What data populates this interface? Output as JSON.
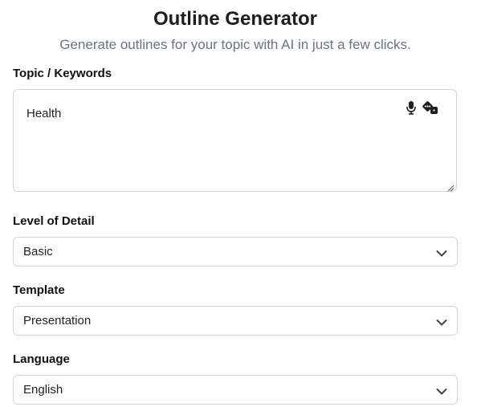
{
  "header": {
    "title": "Outline Generator",
    "subtitle": "Generate outlines for your topic with AI in just a few clicks."
  },
  "topic": {
    "label": "Topic / Keywords",
    "value": "Health",
    "icons": [
      "microphone-icon",
      "dice-icon"
    ]
  },
  "detail": {
    "label": "Level of Detail",
    "selected": "Basic"
  },
  "template": {
    "label": "Template",
    "selected": "Presentation"
  },
  "language": {
    "label": "Language",
    "selected": "English"
  },
  "colors": {
    "border": "#d1d5db",
    "subtitle": "#6b7280",
    "text": "#1f1f1f"
  }
}
